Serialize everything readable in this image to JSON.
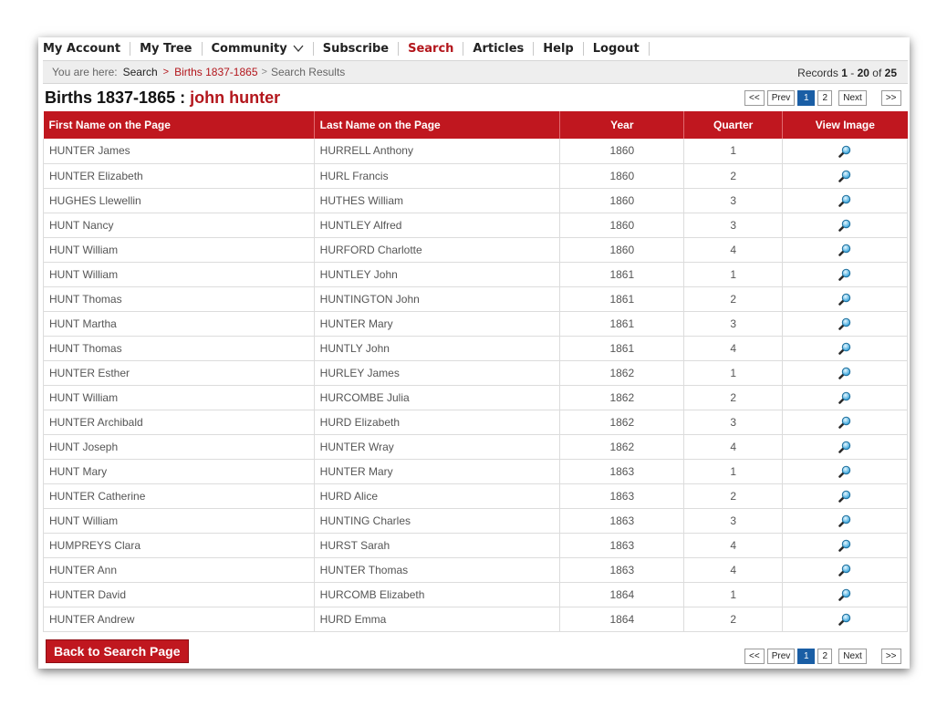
{
  "nav": {
    "items": [
      {
        "label": "My Account",
        "name": "nav-my-account"
      },
      {
        "label": "My Tree",
        "name": "nav-my-tree"
      },
      {
        "label": "Community",
        "name": "nav-community"
      },
      {
        "label": "Subscribe",
        "name": "nav-subscribe"
      },
      {
        "label": "Search",
        "name": "nav-search"
      },
      {
        "label": "Articles",
        "name": "nav-articles"
      },
      {
        "label": "Help",
        "name": "nav-help"
      },
      {
        "label": "Logout",
        "name": "nav-logout"
      }
    ],
    "active": "Search",
    "dropdown_icon": "chevron-down-icon",
    "active_color": "#b3161c"
  },
  "breadcrumb": {
    "prefix": "You are here:",
    "items": [
      "Search",
      "Births 1837-1865",
      "Search Results"
    ],
    "separator": ">"
  },
  "records": {
    "label": "Records",
    "from": "1",
    "dash": "-",
    "to": "20",
    "of_label": "of",
    "total": "25"
  },
  "heading": {
    "title": "Births 1837-1865",
    "sep": ":",
    "query": "john hunter"
  },
  "pager": {
    "first": "<<",
    "prev": "Prev",
    "pages": [
      "1",
      "2"
    ],
    "current": "1",
    "next": "Next",
    "last": ">>"
  },
  "table": {
    "header_color": "#c0171f",
    "columns": [
      "First Name on the Page",
      "Last Name on the Page",
      "Year",
      "Quarter",
      "View Image"
    ],
    "view_icon": "magnifier-icon",
    "rows": [
      [
        "HUNTER James",
        "HURRELL Anthony",
        "1860",
        "1"
      ],
      [
        "HUNTER Elizabeth",
        "HURL Francis",
        "1860",
        "2"
      ],
      [
        "HUGHES Llewellin",
        "HUTHES William",
        "1860",
        "3"
      ],
      [
        "HUNT Nancy",
        "HUNTLEY Alfred",
        "1860",
        "3"
      ],
      [
        "HUNT William",
        "HURFORD Charlotte",
        "1860",
        "4"
      ],
      [
        "HUNT William",
        "HUNTLEY John",
        "1861",
        "1"
      ],
      [
        "HUNT Thomas",
        "HUNTINGTON John",
        "1861",
        "2"
      ],
      [
        "HUNT Martha",
        "HUNTER Mary",
        "1861",
        "3"
      ],
      [
        "HUNT Thomas",
        "HUNTLY John",
        "1861",
        "4"
      ],
      [
        "HUNTER Esther",
        "HURLEY James",
        "1862",
        "1"
      ],
      [
        "HUNT William",
        "HURCOMBE Julia",
        "1862",
        "2"
      ],
      [
        "HUNTER Archibald",
        "HURD Elizabeth",
        "1862",
        "3"
      ],
      [
        "HUNT Joseph",
        "HUNTER Wray",
        "1862",
        "4"
      ],
      [
        "HUNT Mary",
        "HUNTER Mary",
        "1863",
        "1"
      ],
      [
        "HUNTER Catherine",
        "HURD Alice",
        "1863",
        "2"
      ],
      [
        "HUNT William",
        "HUNTING Charles",
        "1863",
        "3"
      ],
      [
        "HUMPREYS Clara",
        "HURST Sarah",
        "1863",
        "4"
      ],
      [
        "HUNTER Ann",
        "HUNTER Thomas",
        "1863",
        "4"
      ],
      [
        "HUNTER David",
        "HURCOMB Elizabeth",
        "1864",
        "1"
      ],
      [
        "HUNTER Andrew",
        "HURD Emma",
        "1864",
        "2"
      ]
    ]
  },
  "back_button": "Back to Search Page"
}
